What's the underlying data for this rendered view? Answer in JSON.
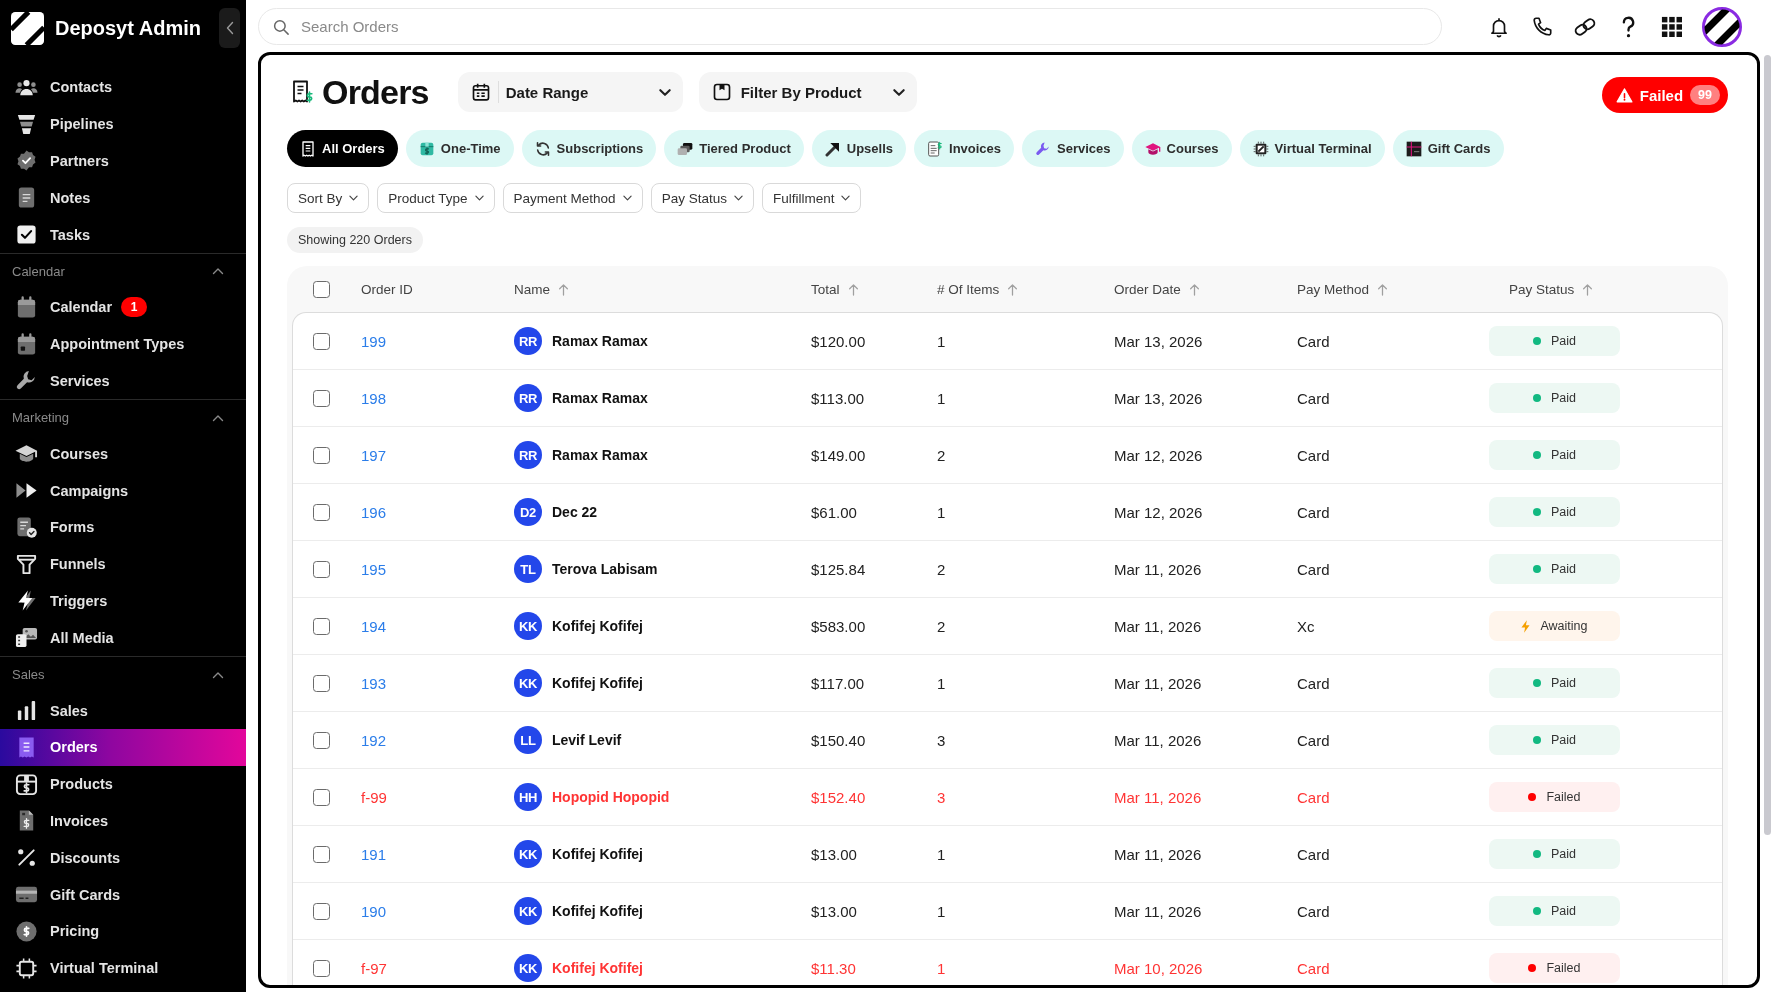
{
  "sidebar": {
    "brand": "Deposyt Admin",
    "sections": [
      {
        "items": [
          {
            "label": "Contacts",
            "selected": false
          },
          {
            "label": "Pipelines",
            "selected": false
          },
          {
            "label": "Partners",
            "selected": false
          },
          {
            "label": "Notes",
            "selected": false
          },
          {
            "label": "Tasks",
            "selected": false
          }
        ]
      },
      {
        "title": "Calendar",
        "expanded": true,
        "items": [
          {
            "label": "Calendar",
            "selected": false,
            "badge": "1"
          },
          {
            "label": "Appointment Types",
            "selected": false
          },
          {
            "label": "Services",
            "selected": false
          }
        ]
      },
      {
        "title": "Marketing",
        "expanded": true,
        "items": [
          {
            "label": "Courses",
            "selected": false
          },
          {
            "label": "Campaigns",
            "selected": false
          },
          {
            "label": "Forms",
            "selected": false
          },
          {
            "label": "Funnels",
            "selected": false
          },
          {
            "label": "Triggers",
            "selected": false
          },
          {
            "label": "All Media",
            "selected": false
          }
        ]
      },
      {
        "title": "Sales",
        "expanded": true,
        "items": [
          {
            "label": "Sales",
            "selected": false
          },
          {
            "label": "Orders",
            "selected": true
          },
          {
            "label": "Products",
            "selected": false
          },
          {
            "label": "Invoices",
            "selected": false
          },
          {
            "label": "Discounts",
            "selected": false
          },
          {
            "label": "Gift Cards",
            "selected": false
          },
          {
            "label": "Pricing",
            "selected": false
          },
          {
            "label": "Virtual Terminal",
            "selected": false
          }
        ]
      }
    ]
  },
  "search": {
    "placeholder": "Search Orders"
  },
  "page": {
    "title": "Orders",
    "date_range": {
      "label": "Date Range"
    },
    "product_filter": {
      "label": "Filter By Product"
    },
    "failed_button": {
      "label": "Failed",
      "count": "99"
    }
  },
  "tabs": [
    {
      "label": "All Orders",
      "selected": true
    },
    {
      "label": "One-Time",
      "selected": false
    },
    {
      "label": "Subscriptions",
      "selected": false
    },
    {
      "label": "Tiered Product",
      "selected": false
    },
    {
      "label": "Upsells",
      "selected": false
    },
    {
      "label": "Invoices",
      "selected": false
    },
    {
      "label": "Services",
      "selected": false
    },
    {
      "label": "Courses",
      "selected": false
    },
    {
      "label": "Virtual Terminal",
      "selected": false
    },
    {
      "label": "Gift Cards",
      "selected": false
    }
  ],
  "filters": [
    "Sort By",
    "Product Type",
    "Payment Method",
    "Pay Status",
    "Fulfillment"
  ],
  "result_count": "Showing 220 Orders",
  "table": {
    "select_all": {
      "checked": false
    },
    "columns": [
      {
        "label": "Order ID",
        "sortable": false
      },
      {
        "label": "Name",
        "sortable": true
      },
      {
        "label": "Total",
        "sortable": true
      },
      {
        "label": "# Of Items",
        "sortable": true
      },
      {
        "label": "Order Date",
        "sortable": true
      },
      {
        "label": "Pay Method",
        "sortable": true
      },
      {
        "label": "Pay Status",
        "sortable": true
      }
    ],
    "rows": [
      {
        "checked": false,
        "order_id": "199",
        "initials": "RR",
        "name": "Ramax Ramax",
        "total": "$120.00",
        "items": "1",
        "order_date": "Mar 13, 2026",
        "pay_method": "Card",
        "pay_status": {
          "kind": "paid",
          "label": "Paid"
        }
      },
      {
        "checked": false,
        "order_id": "198",
        "initials": "RR",
        "name": "Ramax Ramax",
        "total": "$113.00",
        "items": "1",
        "order_date": "Mar 13, 2026",
        "pay_method": "Card",
        "pay_status": {
          "kind": "paid",
          "label": "Paid"
        }
      },
      {
        "checked": false,
        "order_id": "197",
        "initials": "RR",
        "name": "Ramax Ramax",
        "total": "$149.00",
        "items": "2",
        "order_date": "Mar 12, 2026",
        "pay_method": "Card",
        "pay_status": {
          "kind": "paid",
          "label": "Paid"
        }
      },
      {
        "checked": false,
        "order_id": "196",
        "initials": "D2",
        "name": "Dec 22",
        "total": "$61.00",
        "items": "1",
        "order_date": "Mar 12, 2026",
        "pay_method": "Card",
        "pay_status": {
          "kind": "paid",
          "label": "Paid"
        }
      },
      {
        "checked": false,
        "order_id": "195",
        "initials": "TL",
        "name": "Terova Labisam",
        "total": "$125.84",
        "items": "2",
        "order_date": "Mar 11, 2026",
        "pay_method": "Card",
        "pay_status": {
          "kind": "paid",
          "label": "Paid"
        }
      },
      {
        "checked": false,
        "order_id": "194",
        "initials": "KK",
        "name": "Kofifej Kofifej",
        "total": "$583.00",
        "items": "2",
        "order_date": "Mar 11, 2026",
        "pay_method": "Xc",
        "pay_status": {
          "kind": "awaiting",
          "label": "Awaiting"
        }
      },
      {
        "checked": false,
        "order_id": "193",
        "initials": "KK",
        "name": "Kofifej Kofifej",
        "total": "$117.00",
        "items": "1",
        "order_date": "Mar 11, 2026",
        "pay_method": "Card",
        "pay_status": {
          "kind": "paid",
          "label": "Paid"
        }
      },
      {
        "checked": false,
        "order_id": "192",
        "initials": "LL",
        "name": "Levif Levif",
        "total": "$150.40",
        "items": "3",
        "order_date": "Mar 11, 2026",
        "pay_method": "Card",
        "pay_status": {
          "kind": "paid",
          "label": "Paid"
        }
      },
      {
        "checked": false,
        "order_id": "f-99",
        "initials": "HH",
        "name": "Hopopid Hopopid",
        "total": "$152.40",
        "items": "3",
        "order_date": "Mar 11, 2026",
        "pay_method": "Card",
        "pay_status": {
          "kind": "failed",
          "label": "Failed"
        }
      },
      {
        "checked": false,
        "order_id": "191",
        "initials": "KK",
        "name": "Kofifej Kofifej",
        "total": "$13.00",
        "items": "1",
        "order_date": "Mar 11, 2026",
        "pay_method": "Card",
        "pay_status": {
          "kind": "paid",
          "label": "Paid"
        }
      },
      {
        "checked": false,
        "order_id": "190",
        "initials": "KK",
        "name": "Kofifej Kofifej",
        "total": "$13.00",
        "items": "1",
        "order_date": "Mar 11, 2026",
        "pay_method": "Card",
        "pay_status": {
          "kind": "paid",
          "label": "Paid"
        }
      },
      {
        "checked": false,
        "order_id": "f-97",
        "initials": "KK",
        "name": "Kofifej Kofifej",
        "total": "$11.30",
        "items": "1",
        "order_date": "Mar 10, 2026",
        "pay_method": "Card",
        "pay_status": {
          "kind": "failed",
          "label": "Failed"
        }
      }
    ]
  }
}
